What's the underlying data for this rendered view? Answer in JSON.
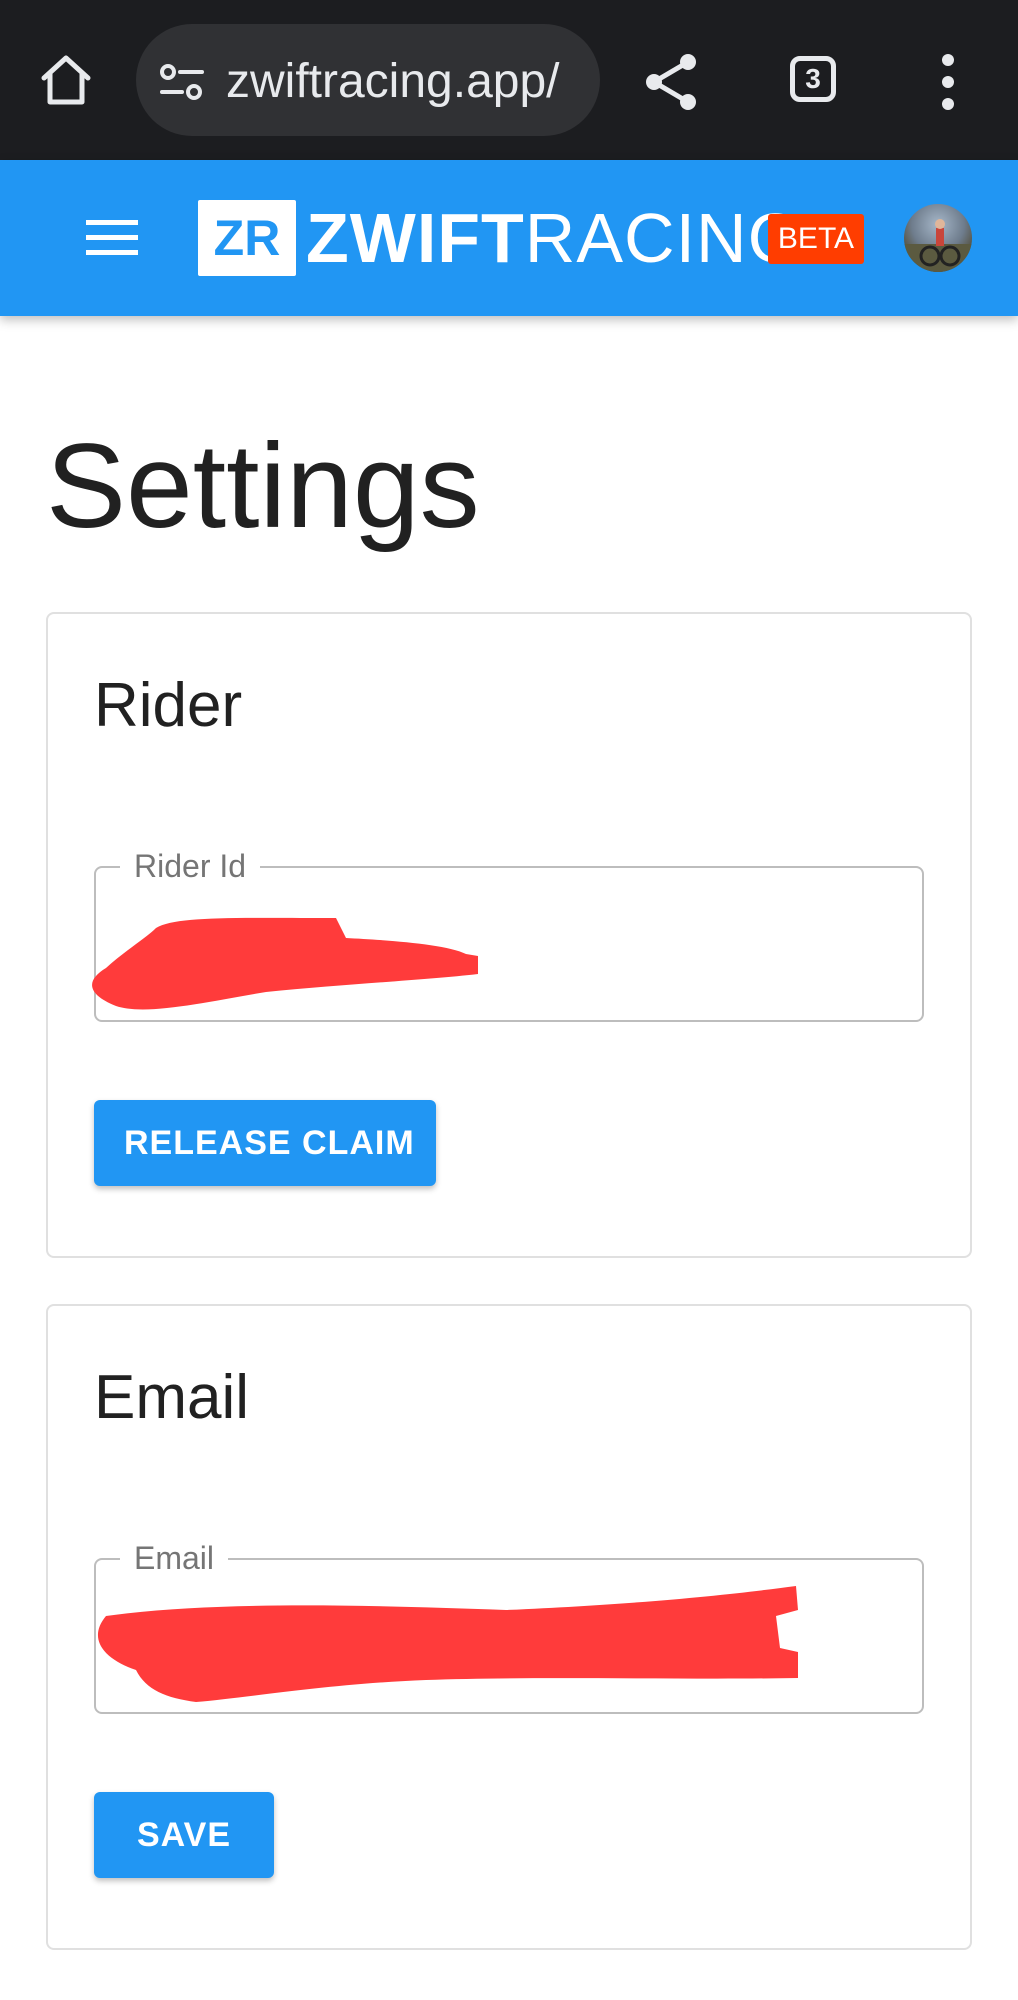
{
  "browser": {
    "url": "zwiftracing.app/",
    "tab_count": "3",
    "icons": [
      "home-icon",
      "site-settings-icon",
      "share-icon",
      "tabs-icon",
      "more-vert-icon"
    ]
  },
  "header": {
    "logo_mark": "ZR",
    "brand_bold": "ZWIFT",
    "brand_light": "RACING",
    "badge": "BETA",
    "colors": {
      "primary": "#2196f3",
      "badge": "#ff3d00"
    }
  },
  "page": {
    "title": "Settings"
  },
  "rider_card": {
    "title": "Rider",
    "field_label": "Rider Id",
    "button_label": "RELEASE CLAIM"
  },
  "email_card": {
    "title": "Email",
    "field_label": "Email",
    "button_label": "SAVE"
  }
}
